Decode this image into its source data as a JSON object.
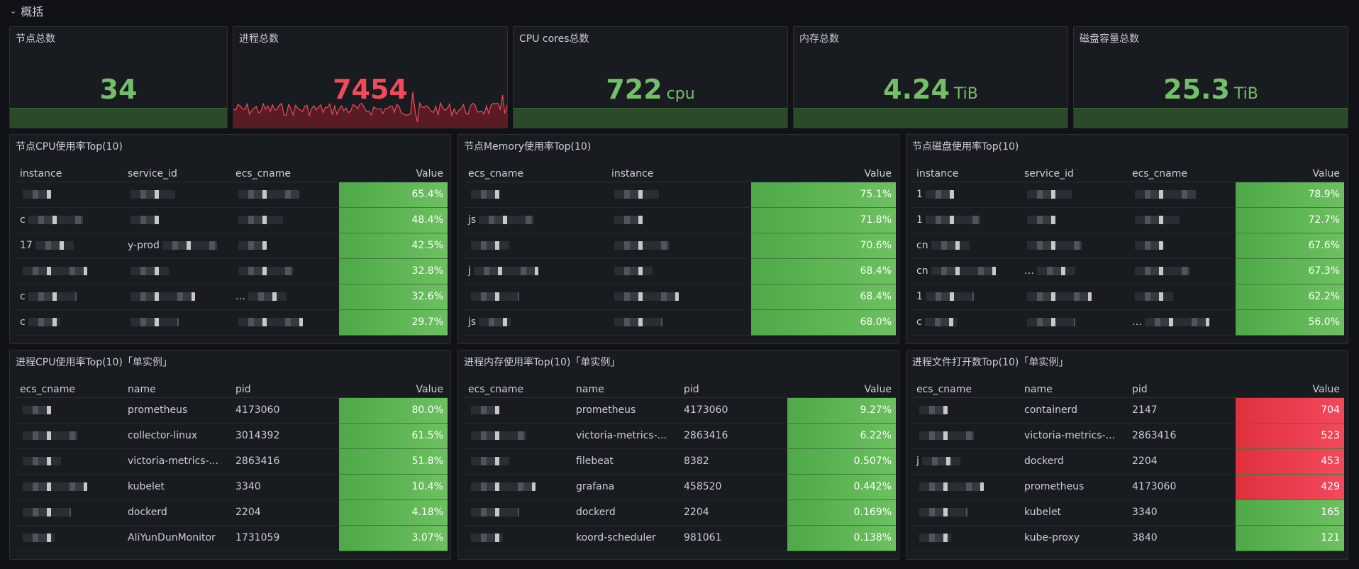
{
  "row": {
    "title": "概括",
    "chevron": "chevron-down-icon"
  },
  "stats": [
    {
      "title": "节点总数",
      "value": "34",
      "unit": ""
    },
    {
      "title": "进程总数",
      "value": "7454",
      "unit": ""
    },
    {
      "title": "CPU cores总数",
      "value": "722",
      "unit": "cpu"
    },
    {
      "title": "内存总数",
      "value": "4.24",
      "unit": "TiB"
    },
    {
      "title": "磁盘容量总数",
      "value": "25.3",
      "unit": "TiB"
    }
  ],
  "colors": {
    "green": "#73bf69",
    "red": "#f2495c",
    "bg": "#111217",
    "panel": "#181b1f"
  },
  "tables": {
    "node_cpu": {
      "title": "节点CPU使用率Top(10)",
      "columns": [
        "instance",
        "service_id",
        "ecs_cname",
        "Value"
      ],
      "rows": [
        [
          "",
          "",
          "",
          "65.4%"
        ],
        [
          "c",
          "",
          "",
          "48.4%"
        ],
        [
          "17",
          "y-prod",
          "",
          "42.5%"
        ],
        [
          "",
          "",
          "",
          "32.8%"
        ],
        [
          "c",
          "",
          "…",
          "32.6%"
        ],
        [
          "c",
          "",
          "",
          "29.7%"
        ]
      ]
    },
    "node_mem": {
      "title": "节点Memory使用率Top(10)",
      "columns": [
        "ecs_cname",
        "instance",
        "Value"
      ],
      "rows": [
        [
          "",
          "",
          "75.1%"
        ],
        [
          "js",
          "",
          "71.8%"
        ],
        [
          "",
          "",
          "70.6%"
        ],
        [
          "j",
          "",
          "68.4%"
        ],
        [
          "",
          "",
          "68.4%"
        ],
        [
          "js",
          "",
          "68.0%"
        ]
      ]
    },
    "node_disk": {
      "title": "节点磁盘使用率Top(10)",
      "columns": [
        "instance",
        "service_id",
        "ecs_cname",
        "Value"
      ],
      "rows": [
        [
          "1",
          "",
          "",
          "78.9%"
        ],
        [
          "1",
          "",
          "",
          "72.7%"
        ],
        [
          "cn",
          "",
          "",
          "67.6%"
        ],
        [
          "cn",
          "…",
          "",
          "67.3%"
        ],
        [
          "1",
          "",
          "",
          "62.2%"
        ],
        [
          "c",
          "",
          "…",
          "56.0%"
        ]
      ]
    },
    "proc_cpu": {
      "title": "进程CPU使用率Top(10)「单实例」",
      "columns": [
        "ecs_cname",
        "name",
        "pid",
        "Value"
      ],
      "rows": [
        [
          "",
          "prometheus",
          "4173060",
          "80.0%"
        ],
        [
          "",
          "collector-linux",
          "3014392",
          "61.5%"
        ],
        [
          "",
          "victoria-metrics-...",
          "2863416",
          "51.8%"
        ],
        [
          "",
          "kubelet",
          "3340",
          "10.4%"
        ],
        [
          "",
          "dockerd",
          "2204",
          "4.18%"
        ],
        [
          "",
          "AliYunDunMonitor",
          "1731059",
          "3.07%"
        ]
      ]
    },
    "proc_mem": {
      "title": "进程内存使用率Top(10)「单实例」",
      "columns": [
        "ecs_cname",
        "name",
        "pid",
        "Value"
      ],
      "rows": [
        [
          "",
          "prometheus",
          "4173060",
          "9.27%"
        ],
        [
          "",
          "victoria-metrics-...",
          "2863416",
          "6.22%"
        ],
        [
          "",
          "filebeat",
          "8382",
          "0.507%"
        ],
        [
          "",
          "grafana",
          "458520",
          "0.442%"
        ],
        [
          "",
          "dockerd",
          "2204",
          "0.169%"
        ],
        [
          "",
          "koord-scheduler",
          "981061",
          "0.138%"
        ]
      ]
    },
    "proc_fd": {
      "title": "进程文件打开数Top(10)「单实例」",
      "columns": [
        "ecs_cname",
        "name",
        "pid",
        "Value"
      ],
      "rows": [
        [
          "",
          "containerd",
          "2147",
          "704"
        ],
        [
          "",
          "victoria-metrics-...",
          "2863416",
          "523"
        ],
        [
          "j",
          "dockerd",
          "2204",
          "453"
        ],
        [
          "",
          "prometheus",
          "4173060",
          "429"
        ],
        [
          "",
          "kubelet",
          "3340",
          "165"
        ],
        [
          "",
          "kube-proxy",
          "3840",
          "121"
        ]
      ],
      "red_rows": 4
    }
  }
}
